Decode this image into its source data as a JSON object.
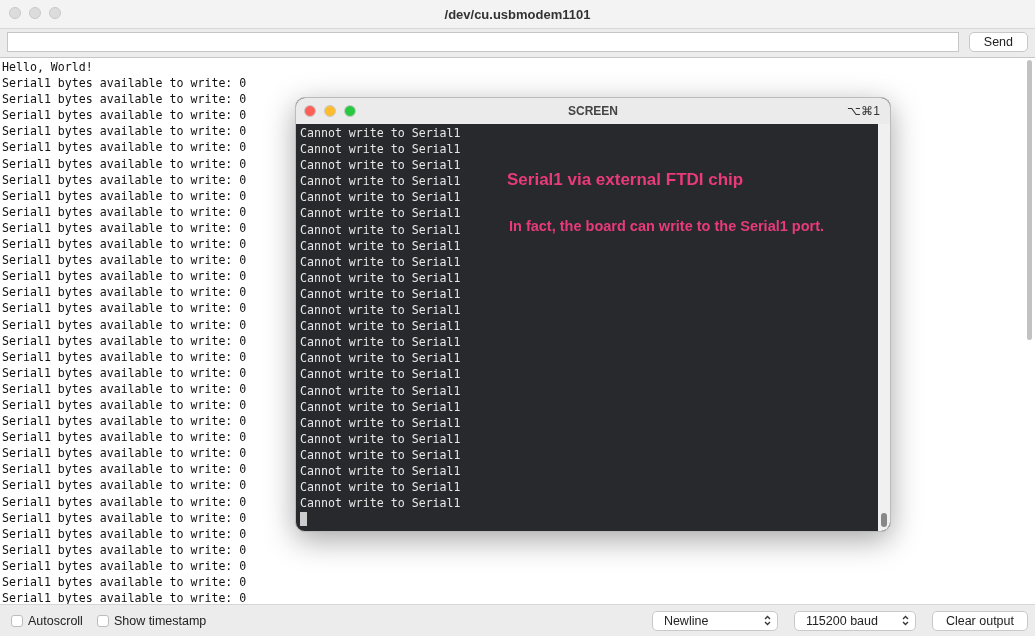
{
  "window": {
    "title": "/dev/cu.usbmodem1101"
  },
  "send_bar": {
    "button": "Send"
  },
  "output_lines": [
    "Hello, World!",
    "Serial1 bytes available to write: 0",
    "Serial1 bytes available to write: 0",
    "Serial1 bytes available to write: 0",
    "Serial1 bytes available to write: 0",
    "Serial1 bytes available to write: 0",
    "Serial1 bytes available to write: 0",
    "Serial1 bytes available to write: 0",
    "Serial1 bytes available to write: 0",
    "Serial1 bytes available to write: 0",
    "Serial1 bytes available to write: 0",
    "Serial1 bytes available to write: 0",
    "Serial1 bytes available to write: 0",
    "Serial1 bytes available to write: 0",
    "Serial1 bytes available to write: 0",
    "Serial1 bytes available to write: 0",
    "Serial1 bytes available to write: 0",
    "Serial1 bytes available to write: 0",
    "Serial1 bytes available to write: 0",
    "Serial1 bytes available to write: 0",
    "Serial1 bytes available to write: 0",
    "Serial1 bytes available to write: 0",
    "Serial1 bytes available to write: 0",
    "Serial1 bytes available to write: 0",
    "Serial1 bytes available to write: 0",
    "Serial1 bytes available to write: 0",
    "Serial1 bytes available to write: 0",
    "Serial1 bytes available to write: 0",
    "Serial1 bytes available to write: 0",
    "Serial1 bytes available to write: 0",
    "Serial1 bytes available to write: 0",
    "Serial1 bytes available to write: 0",
    "Serial1 bytes available to write: 0",
    "Serial1 bytes available to write: 0"
  ],
  "bottom_bar": {
    "checkboxes": [
      {
        "label": "Autoscroll",
        "checked": false
      },
      {
        "label": "Show timestamp",
        "checked": false
      }
    ],
    "line_ending": "Newline",
    "baud_rate": "115200 baud",
    "clear_button": "Clear output"
  },
  "screen_window": {
    "title": "SCREEN",
    "shortcut": "⌥⌘1",
    "lines": [
      "Cannot write to Serial1",
      "Cannot write to Serial1",
      "Cannot write to Serial1",
      "Cannot write to Serial1",
      "Cannot write to Serial1",
      "Cannot write to Serial1",
      "Cannot write to Serial1",
      "Cannot write to Serial1",
      "Cannot write to Serial1",
      "Cannot write to Serial1",
      "Cannot write to Serial1",
      "Cannot write to Serial1",
      "Cannot write to Serial1",
      "Cannot write to Serial1",
      "Cannot write to Serial1",
      "Cannot write to Serial1",
      "Cannot write to Serial1",
      "Cannot write to Serial1",
      "Cannot write to Serial1",
      "Cannot write to Serial1",
      "Cannot write to Serial1",
      "Cannot write to Serial1",
      "Cannot write to Serial1",
      "Cannot write to Serial1"
    ],
    "annotations": [
      {
        "text": "Serial1 via external FTDI chip",
        "kind": "heading"
      },
      {
        "text": "In fact, the board can write to the Serial1 port.",
        "kind": "note"
      }
    ]
  }
}
